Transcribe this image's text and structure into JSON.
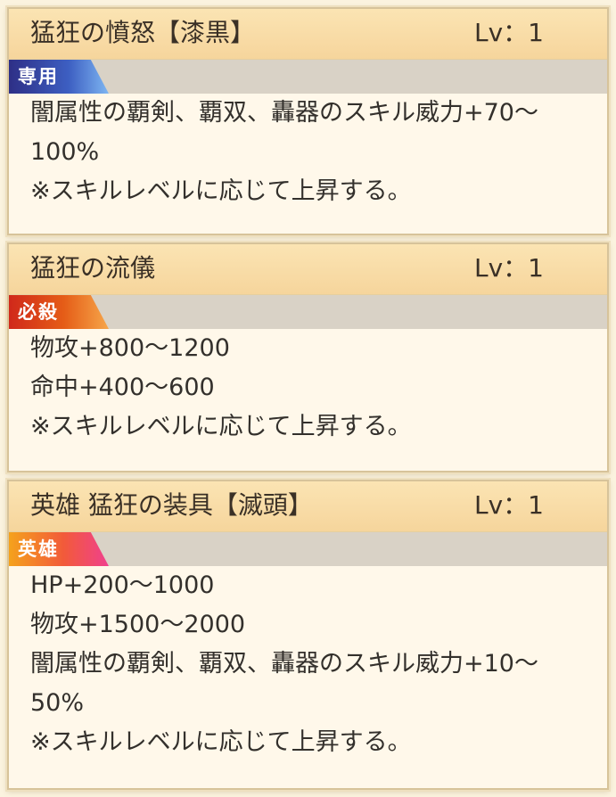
{
  "skills": [
    {
      "name": "猛狂の憤怒【漆黒】",
      "level": "Lv：1",
      "tag": "専用",
      "lines": [
        "闇属性の覇剣、覇双、轟器のスキル威力+70～",
        "100%",
        "※スキルレベルに応じて上昇する。"
      ]
    },
    {
      "name": "猛狂の流儀",
      "level": "Lv：1",
      "tag": "必殺",
      "lines": [
        "物攻+800～1200",
        "命中+400～600",
        "※スキルレベルに応じて上昇する。"
      ]
    },
    {
      "name": "英雄 猛狂の装具【滅頭】",
      "level": "Lv：1",
      "tag": "英雄",
      "lines": [
        "HP+200～1000",
        "物攻+1500～2000",
        "闇属性の覇剣、覇双、轟器のスキル威力+10～",
        "50%",
        "※スキルレベルに応じて上昇する。"
      ]
    }
  ],
  "colors": {
    "header": "#f6d59c",
    "body": "#fff8ea",
    "tag_bar": "#d9d2c6",
    "tag_exclusive": "#3d5fc2",
    "tag_special": "#e55d17",
    "tag_hero": "#f25a3a"
  }
}
